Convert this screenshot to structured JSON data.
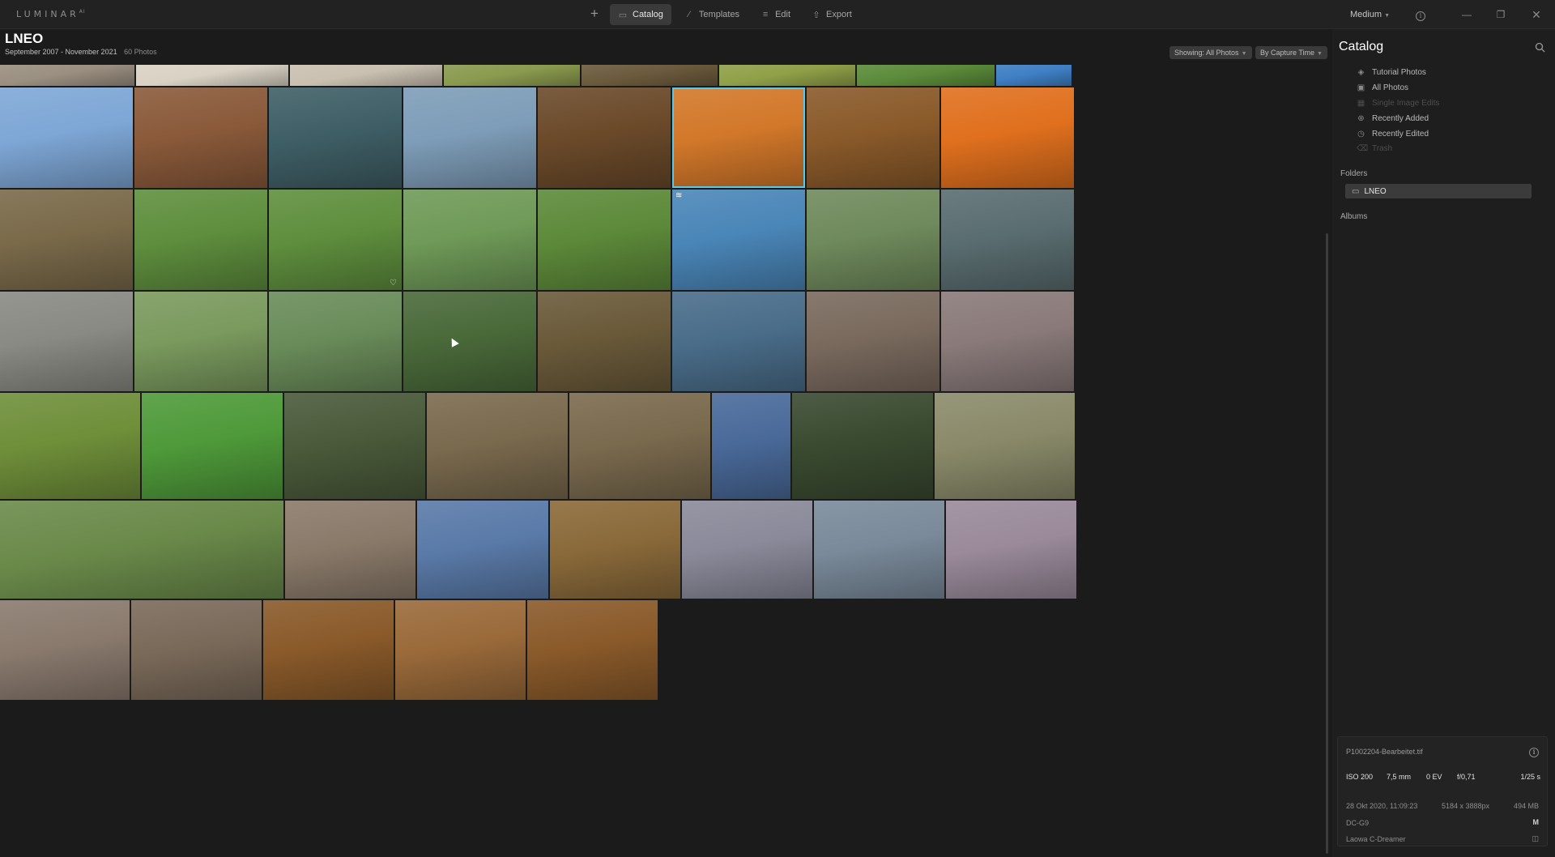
{
  "app": {
    "logo": "LUMINAR",
    "logo_sup": "AI"
  },
  "nav": {
    "add_label": "+",
    "tabs": [
      {
        "label": "Catalog",
        "icon": "folder-icon",
        "active": true
      },
      {
        "label": "Templates",
        "icon": "wand-icon",
        "active": false
      },
      {
        "label": "Edit",
        "icon": "sliders-icon",
        "active": false
      },
      {
        "label": "Export",
        "icon": "share-icon",
        "active": false
      }
    ],
    "view_size": "Medium"
  },
  "header": {
    "title": "LNEO",
    "date_range": "September 2007 - November 2021",
    "photo_count": "60 Photos",
    "showing_filter": "Showing: All Photos",
    "sort": "By Capture Time"
  },
  "grid": {
    "rows": [
      [
        "#9a8f80",
        "#d9d2c4",
        "#c9c0b0",
        "#8a9a4e",
        "#6b5a3c",
        "#8fa048",
        "#5b8b3a",
        "#3f7fc4"
      ],
      [
        "#7ea7d6",
        "#8a5a3a",
        "#3f5f66",
        "#7e9db8",
        "#6b4a2a",
        "#d2782a",
        "#8a5a2a",
        "#e0701e"
      ],
      [
        "#7a6a4a",
        "#5f8f3e",
        "#5f8f3e",
        "#6f9a58",
        "#5d8a3a",
        "#4a86b8",
        "#6f8a5c",
        "#5a6d70"
      ],
      [
        "#8a8a84",
        "#7a9a5e",
        "#6a8c5a",
        "#4a6a3a",
        "#6a5a3a",
        "#4a6d8a",
        "#7a6a5e",
        "#8a7a7a"
      ],
      [
        "#6f8f3a",
        "#4f9a3a",
        "#4a5a3a",
        "#7a6a4e",
        "#7a6a4e",
        "#4a6a9a",
        "#3a4a30",
        "#8a8a6a"
      ],
      [
        "#6a8a4a",
        "#8a7a6a",
        "#5a7aa8",
        "#8a6a3a",
        "#8a8a9a",
        "#7a8a9a",
        "#9a8a9a"
      ],
      [
        "#8a7a6e",
        "#7a6a5a",
        "#8a5a2a",
        "#9a6a3a",
        "#8a5a2a"
      ]
    ],
    "selected": "1-5",
    "edited": "2-5"
  },
  "panel": {
    "title": "Catalog",
    "items": [
      {
        "label": "Tutorial Photos",
        "icon": "learn-icon",
        "disabled": false
      },
      {
        "label": "All Photos",
        "icon": "photos-icon",
        "disabled": false
      },
      {
        "label": "Single Image Edits",
        "icon": "grid-icon",
        "disabled": true
      },
      {
        "label": "Recently Added",
        "icon": "plus-circle-icon",
        "disabled": false
      },
      {
        "label": "Recently Edited",
        "icon": "clock-icon",
        "disabled": false
      },
      {
        "label": "Trash",
        "icon": "trash-icon",
        "disabled": true
      }
    ],
    "folders_label": "Folders",
    "folder_lneo": "LNEO",
    "albums_label": "Albums"
  },
  "info": {
    "filename": "P1002204-Bearbeitet.tif",
    "iso": "ISO 200",
    "focal": "7,5 mm",
    "ev": "0 EV",
    "aperture": "f/0,71",
    "shutter": "1/25 s",
    "datetime": "28 Okt 2020, 11:09:23",
    "dimensions": "5184 x 3888px",
    "filesize": "494 MB",
    "camera": "DC-G9",
    "mode": "M",
    "lens": "Laowa C-Dreamer"
  }
}
